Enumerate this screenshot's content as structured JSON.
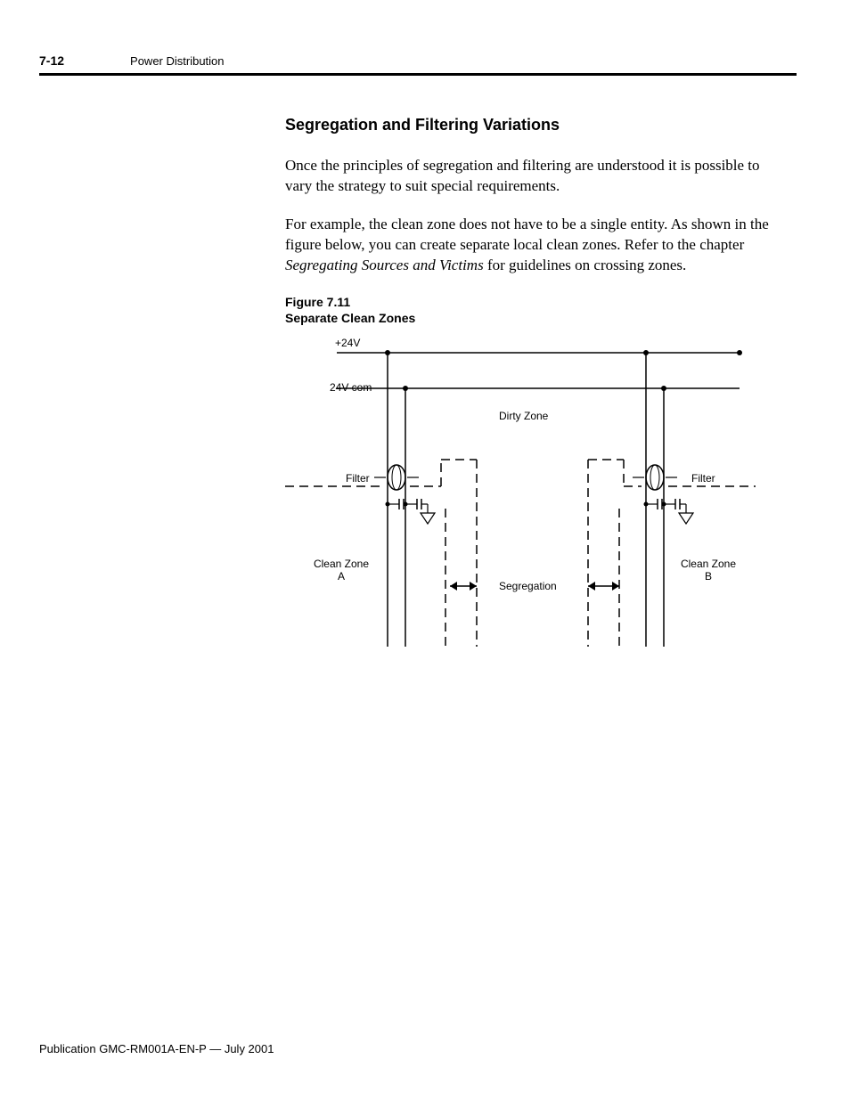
{
  "header": {
    "page_number": "7-12",
    "chapter": "Power Distribution"
  },
  "section": {
    "heading": "Segregation and Filtering Variations",
    "para1": "Once the principles of segregation and filtering are understood it is possible to vary the strategy to suit special requirements.",
    "para2_a": "For example, the clean zone does not have to be a single entity. As shown in the figure below, you can create separate local clean zones. Refer to the chapter ",
    "para2_italic": "Segregating Sources and Victims",
    "para2_b": " for guidelines on crossing zones."
  },
  "figure": {
    "number": "Figure 7.11",
    "title": "Separate Clean Zones",
    "labels": {
      "p24v": "+24V",
      "com24v": "24V com",
      "dirty": "Dirty Zone",
      "filter_l": "Filter",
      "filter_r": "Filter",
      "cza_l1": "Clean Zone",
      "cza_l2": "A",
      "czb_l1": "Clean Zone",
      "czb_l2": "B",
      "seg": "Segregation"
    }
  },
  "footer": {
    "pubinfo": "Publication GMC-RM001A-EN-P — July 2001"
  }
}
